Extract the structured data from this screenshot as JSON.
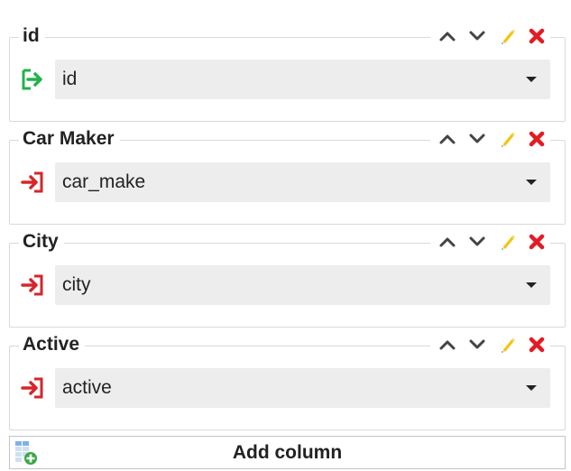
{
  "columns": [
    {
      "title": "id",
      "field": "id",
      "field_kind": "key",
      "field_icon": "key-enter-icon"
    },
    {
      "title": "Car Maker",
      "field": "car_make",
      "field_kind": "field",
      "field_icon": "field-enter-icon"
    },
    {
      "title": "City",
      "field": "city",
      "field_kind": "field",
      "field_icon": "field-enter-icon"
    },
    {
      "title": "Active",
      "field": "active",
      "field_kind": "field",
      "field_icon": "field-enter-icon"
    }
  ],
  "tools": [
    "move-up-icon",
    "move-down-icon",
    "edit-pencil-icon",
    "delete-x-icon"
  ],
  "add_column": {
    "label": "Add column",
    "icon": "add-column-icon"
  },
  "colors": {
    "key_icon": "#22b24c",
    "field_icon": "#d6262b",
    "delete": "#e31b23",
    "pencil": "#f2c511",
    "chevron": "#444444",
    "select_bg": "#ededed"
  }
}
